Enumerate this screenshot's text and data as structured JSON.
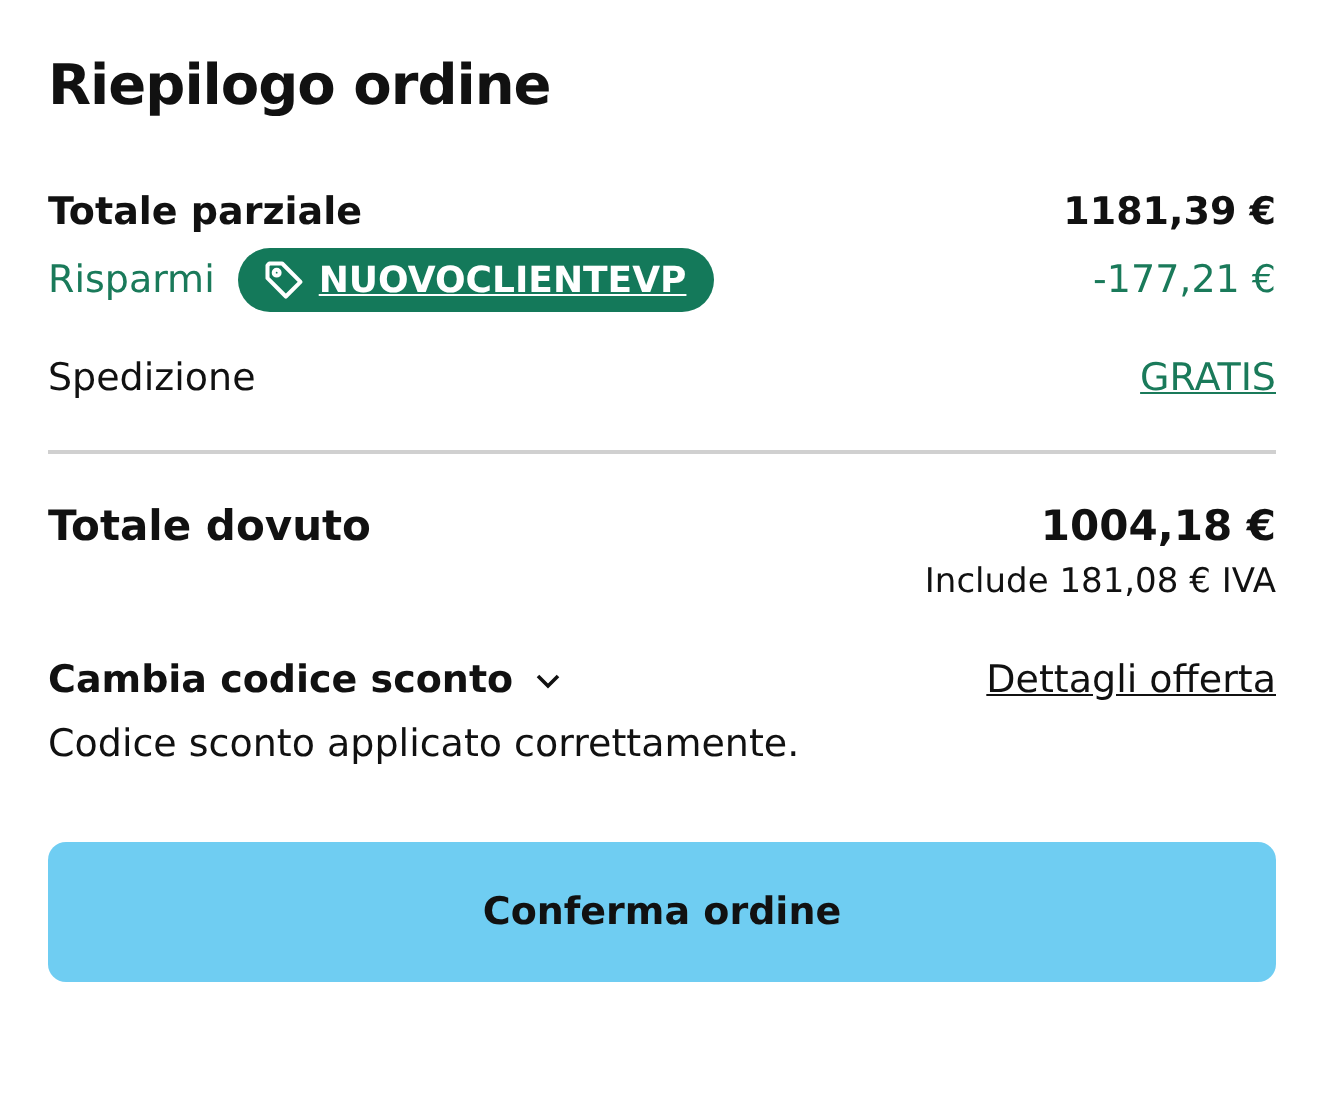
{
  "title": "Riepilogo ordine",
  "subtotal": {
    "label": "Totale parziale",
    "value": "1181,39 €"
  },
  "savings": {
    "label": "Risparmi",
    "code": "NUOVOCLIENTEVP",
    "value": "-177,21 €"
  },
  "shipping": {
    "label": "Spedizione",
    "value": "GRATIS"
  },
  "total": {
    "label": "Totale dovuto",
    "value": "1004,18 €",
    "tax_note": "Include 181,08 € IVA"
  },
  "discount": {
    "toggle": "Cambia codice sconto",
    "expanded": false,
    "details_link": "Dettagli offerta",
    "message": "Codice sconto applicato correttamente."
  },
  "confirm_button": "Conferma ordine"
}
